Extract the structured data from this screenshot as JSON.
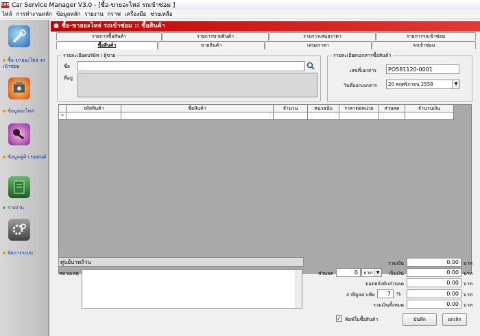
{
  "window": {
    "title": "Car Service Manager V3.0 - [ซื้อ-ขายอะไหล่ รถเข้าซ่อม ]",
    "app_icon_text": "CAR"
  },
  "menu": [
    "ไฟล์",
    "การทำงานหลัก",
    "ข้อมูลหลัก",
    "รายงาน",
    "กราฟ",
    "เครื่องมือ",
    "ช่วยเหลือ"
  ],
  "sidebar": {
    "items": [
      {
        "label": "ซื้อ-ขายอะไหล่ รถเข้าซ่อม",
        "icon": "wrench-icon"
      },
      {
        "label": "ข้อมูลอะไหล่",
        "icon": "engine-icon"
      },
      {
        "label": "ข้อมูลคู่ค้า ขอมนต์",
        "icon": "keys-icon"
      },
      {
        "label": "รายงาน",
        "icon": "report-book-icon"
      },
      {
        "label": "จัดการระบบ",
        "icon": "gears-icon"
      }
    ]
  },
  "form": {
    "header": "ซื้อ-ขายอะไหล่ รถเข้าซ่อม :: ซื้อสินค้า",
    "tabs_top": [
      "รายการซื้อสินค้า",
      "รายการขายสินค้า",
      "รายการเสนอราคา",
      "รายการรถเข้าซ่อม"
    ],
    "tabs_bottom": [
      "ซื้อสินค้า",
      "ขายสินค้า",
      "เสนอราคา",
      "รถเข้าซ่อม"
    ],
    "active_tab": "ซื้อสินค้า"
  },
  "supplier": {
    "legend": "รายละเอียดบริษัท / ผู้ขาย",
    "name_label": "ชื่อ",
    "name_value": "",
    "address_label": "ที่อยู่"
  },
  "document": {
    "legend": "รายละเอียดเอกสารซื้อสินค้า",
    "doc_no_label": "เลขที่เอกสาร",
    "doc_no_value": "PO581120-0001",
    "date_label": "วันที่ออกเอกสาร",
    "date_value": "20 พฤศจิกายน 2558"
  },
  "grid": {
    "columns": [
      "",
      "รหัสสินค้า",
      "ชื่อสินค้า",
      "จำนวน",
      "หน่วยนับ",
      "ราคาต่อหน่วย",
      "ส่วนลด",
      "จำนวนเงิน"
    ],
    "new_row_marker": "*"
  },
  "summary": {
    "amount_in_words": "ศูนย์บาทถ้วน",
    "notes_label": "หมายเหตุ",
    "total_label": "รวมเงิน",
    "total_value": "0.00",
    "discount_label": "ส่วนลด",
    "discount_value": "0",
    "discount_unit": "บาท",
    "discount_money_label": "เป็นเงิน",
    "discount_money_value": "0.00",
    "after_discount_label": "ยอดหลังหักส่วนลด",
    "after_discount_value": "0.00",
    "vat_label": "ภาษีมูลค่าเพิ่ม",
    "vat_rate": "7",
    "vat_percent": "%",
    "vat_value": "0.00",
    "grand_total_label": "รวมเงินทั้งหมด",
    "grand_total_value": "0.00",
    "currency": "บาท",
    "print_checkbox_label": "พิมพ์ใบซื้อสินค้า",
    "print_checked": true,
    "save_label": "บันทึก",
    "cancel_label": "ยกเลิก"
  },
  "colors": {
    "header_red": "#c40000",
    "sidebar_label_blue": "#0033aa",
    "grid_background": "#a9a9a9"
  }
}
